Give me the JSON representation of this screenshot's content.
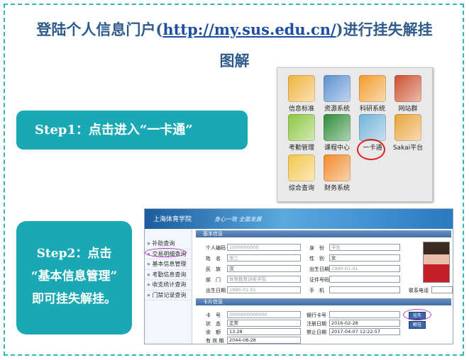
{
  "title": {
    "line1_prefix": "登陆个人信息门户(",
    "line1_link": "http://my.sus.edu.cn/",
    "line1_suffix": ")进行挂失解挂",
    "line2": "图解"
  },
  "step1": {
    "text": "Step1：点击进入“一卡通”"
  },
  "step2": {
    "line1": "Step2：点击",
    "line2": "“基本信息管理”",
    "line3": "即可挂失解挂。"
  },
  "portal": {
    "tiles": [
      {
        "label": "信息标准",
        "icon": "user-card-icon",
        "color": "#f0b23a"
      },
      {
        "label": "资源系统",
        "icon": "building-icon",
        "color": "#5b8fd0"
      },
      {
        "label": "科研系统",
        "icon": "pen-icon",
        "color": "#f29b2a"
      },
      {
        "label": "网站群",
        "icon": "book-icon",
        "color": "#c94f2b"
      },
      {
        "label": "考勤管理",
        "icon": "pencil-check-icon",
        "color": "#8cc63f"
      },
      {
        "label": "课程中心",
        "icon": "calendar-icon",
        "color": "#2e8b3a"
      },
      {
        "label": "一卡通",
        "icon": "card-icon",
        "color": "#6fb1d8"
      },
      {
        "label": "Sakai平台",
        "icon": "laptop-icon",
        "color": "#e8a33a"
      },
      {
        "label": "综合查询",
        "icon": "document-icon",
        "color": "#f3c64a"
      },
      {
        "label": "财务系统",
        "icon": "coins-icon",
        "color": "#f28a2a"
      }
    ]
  },
  "mgmt": {
    "logo": "上海体育学院",
    "slogan": "身心一致  全面发展",
    "sidebar": [
      "补助查询",
      "交易明细查询",
      "基本信息管理",
      "考勤信息查询",
      "收支统计查询",
      "门禁记录查询"
    ],
    "basic_section": "基本信息",
    "card_section": "卡片信息",
    "basic_labels": {
      "id": "个人编码",
      "name": "姓　名",
      "ethnic": "民　族",
      "dept": "部　门",
      "birth": "出生日期",
      "identity": "身　份",
      "gender": "性　别",
      "issue_date": "出生日期",
      "cert": "证件号码",
      "phone": "手　机",
      "contact": "联系电话"
    },
    "basic_values": {
      "id": "1000000000",
      "name": "张三",
      "ethnic": "汉",
      "dept": "体育教育训练学院",
      "birth": "1990-01-01",
      "identity": "学生",
      "gender": "女",
      "issue_date": "1990-01-01",
      "cert": "",
      "phone": "",
      "contact": ""
    },
    "card_labels": {
      "card_no": "卡　号",
      "status": "状　态",
      "balance": "余　额",
      "valid": "有 效 期",
      "bank": "银行卡号",
      "reg_date": "注册日期",
      "ban_date": "禁止日期"
    },
    "card_values": {
      "card_no": "0000000000000",
      "status": "正常",
      "balance": "13.28",
      "valid": "2044-08-28",
      "bank": "",
      "reg_date": "2016-02-28",
      "ban_date": "2017-04-07 12:22:57"
    },
    "buttons": {
      "loss": "挂失",
      "unloss": "解挂"
    }
  }
}
